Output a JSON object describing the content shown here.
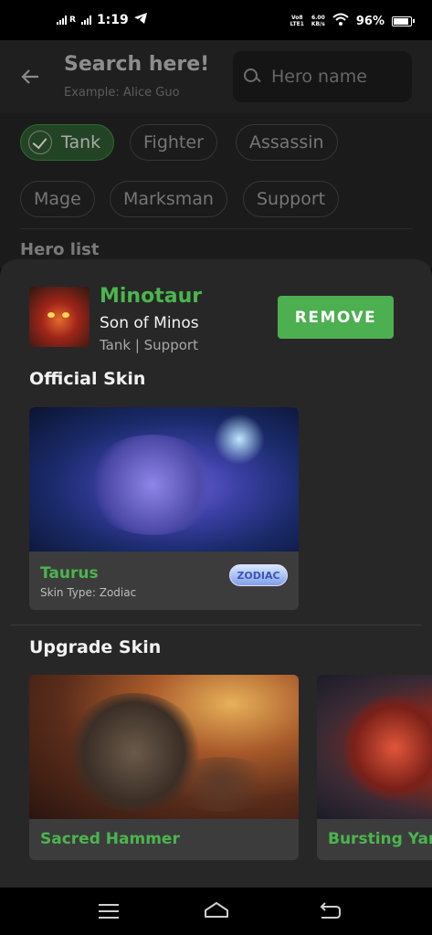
{
  "status_bar": {
    "time": "1:19",
    "signal_label": "R",
    "network_top": "Vo8",
    "network_bottom": "LTE1",
    "speed_top": "6.00",
    "speed_bottom": "KB/s",
    "battery": "96%",
    "battery_level": 0.96
  },
  "header": {
    "title": "Search here!",
    "example": "Example: Alice Guo",
    "search_placeholder": "Hero name"
  },
  "filters": [
    {
      "label": "Tank",
      "selected": true
    },
    {
      "label": "Fighter",
      "selected": false
    },
    {
      "label": "Assassin",
      "selected": false
    },
    {
      "label": "Mage",
      "selected": false
    },
    {
      "label": "Marksman",
      "selected": false
    },
    {
      "label": "Support",
      "selected": false
    }
  ],
  "hero_list_label": "Hero list",
  "hero": {
    "name": "Minotaur",
    "title": "Son of Minos",
    "roles": "Tank | Support",
    "remove_label": "REMOVE"
  },
  "official_skin": {
    "section_title": "Official Skin",
    "skins": [
      {
        "name": "Taurus",
        "type": "Skin Type: Zodiac",
        "badge": "ZODIAC"
      }
    ]
  },
  "upgrade_skin": {
    "section_title": "Upgrade Skin",
    "skins": [
      {
        "name": "Sacred Hammer"
      },
      {
        "name": "Bursting Yama"
      }
    ]
  },
  "colors": {
    "accent": "#4caf50",
    "sheet": "#272727",
    "card": "#3c3c3c"
  }
}
